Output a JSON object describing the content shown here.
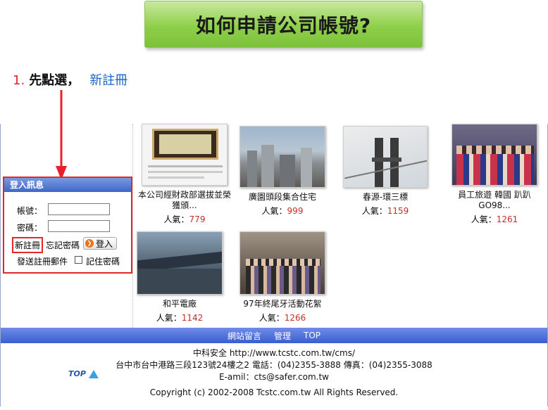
{
  "banner": {
    "title": "如何申請公司帳號?"
  },
  "step": {
    "number": "1.",
    "text": "先點選，",
    "link": "新註冊"
  },
  "login": {
    "header": "登入訊息",
    "account_label": "帳號：",
    "password_label": "密碼：",
    "register_link": "新註冊",
    "forgot_link": "忘記密碼",
    "login_button": "登入",
    "resend_link": "發送註冊郵件",
    "remember_label": "記住密碼"
  },
  "popularity_label": "人氣：",
  "photos": [
    {
      "caption": "本公司經財政部選拔並榮獲頒...",
      "count": "779"
    },
    {
      "caption": "廣園頭段集合住宅",
      "count": "999"
    },
    {
      "caption": "春源-環三標",
      "count": "1159"
    },
    {
      "caption": "員工旅遊 韓國 趴趴GO98...",
      "count": "1261"
    },
    {
      "caption": "和平電廠",
      "count": "1142"
    },
    {
      "caption": "97年終尾牙活動花絮",
      "count": "1266"
    }
  ],
  "footer": {
    "nav": [
      "網站留言",
      "管理",
      "TOP"
    ],
    "company_line": "中科安全  http://www.tcstc.com.tw/cms/",
    "address_line": "台中市台中港路三段123號24樓之2 電話：(04)2355-3888 傳真：(04)2355-3088",
    "email_line": "E-amil：cts@safer.com.tw",
    "copyright": "Copyright (c) 2002-2008 Tcstc.com.tw All Rights Reserved.",
    "logo_text": "TOP"
  },
  "colors": {
    "accent_red": "#e02a2a",
    "banner_green": "#8fcf4a",
    "nav_blue": "#3a5ed0",
    "link_blue": "#1a66c8",
    "count_red": "#c0302a"
  }
}
